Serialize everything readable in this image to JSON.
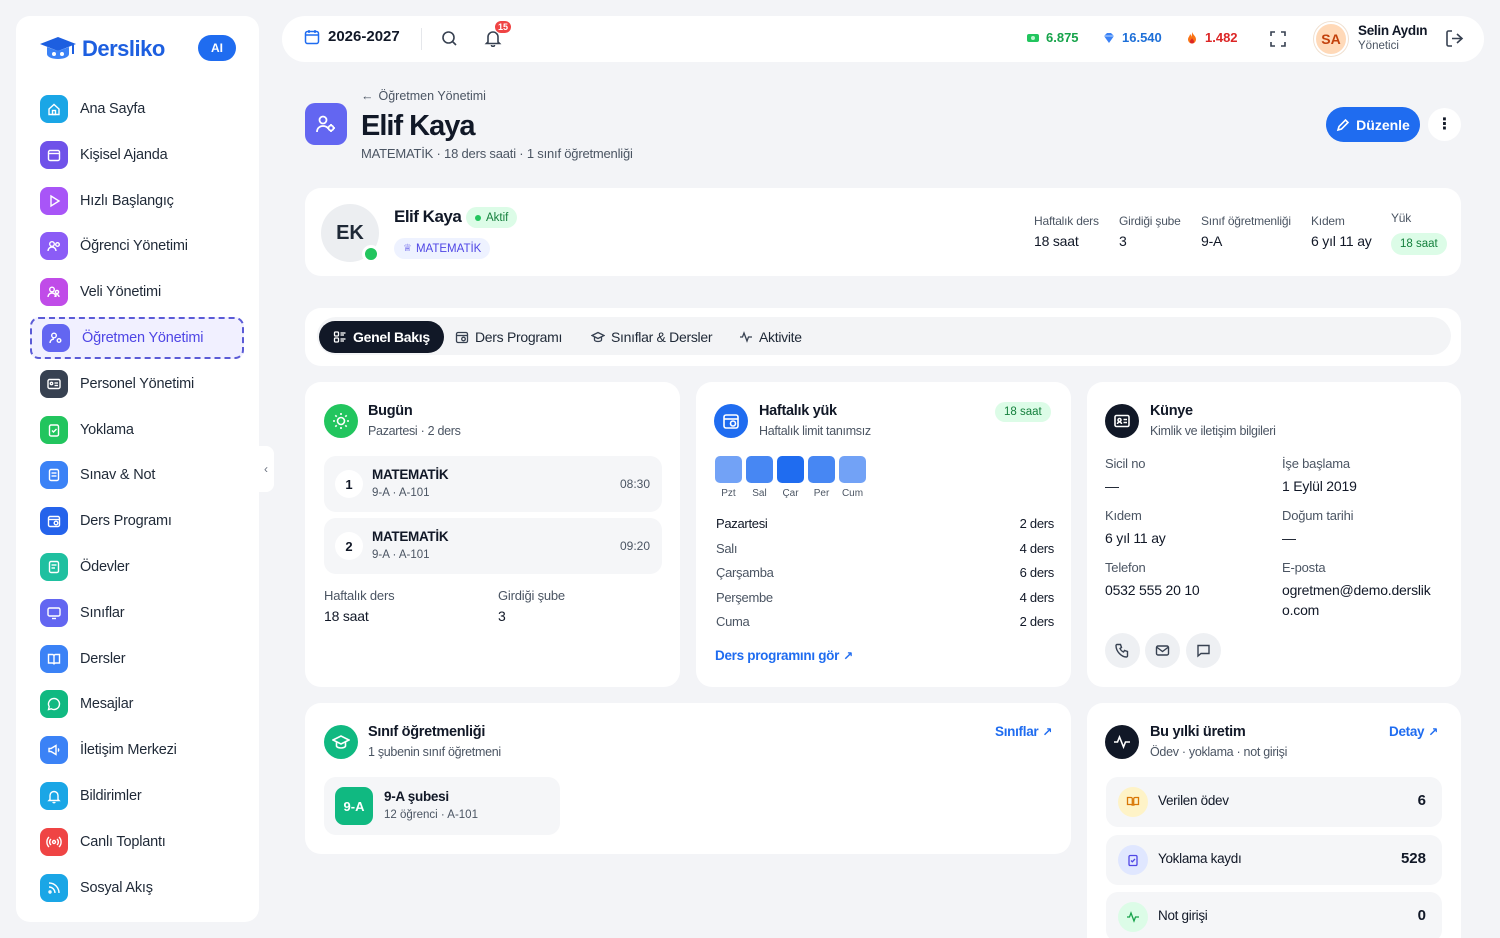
{
  "brand": {
    "name": "Dersliko",
    "ai_badge": "AI"
  },
  "sidebar": {
    "items": [
      {
        "label": "Ana Sayfa",
        "icon": "home-icon",
        "color": "#1aa6e6"
      },
      {
        "label": "Kişisel Ajanda",
        "icon": "calendar-icon",
        "color": "#6f52e9"
      },
      {
        "label": "Hızlı Başlangıç",
        "icon": "play-icon",
        "color": "#a855f7"
      },
      {
        "label": "Öğrenci Yönetimi",
        "icon": "users-icon",
        "color": "#8b5cf6"
      },
      {
        "label": "Veli Yönetimi",
        "icon": "parents-icon",
        "color": "#c04ce8"
      },
      {
        "label": "Öğretmen Yönetimi",
        "icon": "teacher-icon",
        "color": "#6366f1",
        "active": true
      },
      {
        "label": "Personel Yönetimi",
        "icon": "id-card-icon",
        "color": "#374151"
      },
      {
        "label": "Yoklama",
        "icon": "clipboard-check-icon",
        "color": "#22c55e"
      },
      {
        "label": "Sınav & Not",
        "icon": "exam-icon",
        "color": "#3b82f6"
      },
      {
        "label": "Ders Programı",
        "icon": "schedule-icon",
        "color": "#2563eb"
      },
      {
        "label": "Ödevler",
        "icon": "homework-icon",
        "color": "#1fc0a0"
      },
      {
        "label": "Sınıflar",
        "icon": "monitor-icon",
        "color": "#6366f1"
      },
      {
        "label": "Dersler",
        "icon": "book-icon",
        "color": "#3b82f6"
      },
      {
        "label": "Mesajlar",
        "icon": "message-icon",
        "color": "#10b981"
      },
      {
        "label": "İletişim Merkezi",
        "icon": "megaphone-icon",
        "color": "#3b82f6"
      },
      {
        "label": "Bildirimler",
        "icon": "bell-icon",
        "color": "#1aa6e6"
      },
      {
        "label": "Canlı Toplantı",
        "icon": "broadcast-icon",
        "color": "#ef4444"
      },
      {
        "label": "Sosyal Akış",
        "icon": "rss-icon",
        "color": "#1aa6e6"
      }
    ]
  },
  "topbar": {
    "year": "2026-2027",
    "notification_count": "15",
    "stats": [
      {
        "value": "6.875",
        "color": "#16a34a",
        "icon": "cash-icon"
      },
      {
        "value": "16.540",
        "color": "#1d6fd8",
        "icon": "diamond-icon"
      },
      {
        "value": "1.482",
        "color": "#dc2626",
        "icon": "fire-icon"
      }
    ],
    "user": {
      "initials": "SA",
      "name": "Selin Aydın",
      "role": "Yönetici"
    }
  },
  "header": {
    "breadcrumb": "Öğretmen Yönetimi",
    "title": "Elif Kaya",
    "subtitle": "MATEMATİK · 18 ders saati · 1 sınıf öğretmenliği",
    "edit_label": "Düzenle"
  },
  "profile": {
    "initials": "EK",
    "name": "Elif Kaya",
    "status": "Aktif",
    "branch": "MATEMATİK",
    "stats": [
      {
        "label": "Haftalık ders",
        "value": "18 saat"
      },
      {
        "label": "Girdiği şube",
        "value": "3"
      },
      {
        "label": "Sınıf öğretmenliği",
        "value": "9-A"
      },
      {
        "label": "Kıdem",
        "value": "6 yıl 11 ay"
      }
    ],
    "load_label": "Yük",
    "load_value": "18 saat"
  },
  "tabs": [
    {
      "label": "Genel Bakış",
      "icon": "grid-list-icon",
      "active": true
    },
    {
      "label": "Ders Programı",
      "icon": "schedule-icon"
    },
    {
      "label": "Sınıflar & Dersler",
      "icon": "cap-icon"
    },
    {
      "label": "Aktivite",
      "icon": "activity-icon"
    }
  ],
  "today": {
    "title": "Bugün",
    "subtitle": "Pazartesi · 2 ders",
    "lessons": [
      {
        "num": "1",
        "name": "MATEMATİK",
        "room": "9-A · A-101",
        "time": "08:30"
      },
      {
        "num": "2",
        "name": "MATEMATİK",
        "room": "9-A · A-101",
        "time": "09:20"
      }
    ],
    "stats": [
      {
        "label": "Haftalık ders",
        "value": "18 saat"
      },
      {
        "label": "Girdiği şube",
        "value": "3"
      }
    ]
  },
  "weekly": {
    "title": "Haftalık yük",
    "subtitle": "Haftalık limit tanımsız",
    "badge": "18 saat",
    "days": [
      {
        "short": "Pzt",
        "name": "Pazartesi",
        "lessons": "2 ders",
        "level": 2
      },
      {
        "short": "Sal",
        "name": "Salı",
        "lessons": "4 ders",
        "level": 4
      },
      {
        "short": "Çar",
        "name": "Çarşamba",
        "lessons": "6 ders",
        "level": 6
      },
      {
        "short": "Per",
        "name": "Perşembe",
        "lessons": "4 ders",
        "level": 4
      },
      {
        "short": "Cum",
        "name": "Cuma",
        "lessons": "2 ders",
        "level": 2
      }
    ],
    "link": "Ders programını gör"
  },
  "kunye": {
    "title": "Künye",
    "subtitle": "Kimlik ve iletişim bilgileri",
    "fields": [
      {
        "label": "Sicil no",
        "value": "—"
      },
      {
        "label": "İşe başlama",
        "value": "1 Eylül 2019"
      },
      {
        "label": "Kıdem",
        "value": "6 yıl 11 ay"
      },
      {
        "label": "Doğum tarihi",
        "value": "—"
      },
      {
        "label": "Telefon",
        "value": "0532 555 20 10"
      },
      {
        "label": "E-posta",
        "value": "ogretmen@demo.derslik o.com"
      }
    ]
  },
  "class_teacher": {
    "title": "Sınıf öğretmenliği",
    "subtitle": "1 şubenin sınıf öğretmeni",
    "link": "Sınıflar",
    "branch_code": "9-A",
    "branch_name": "9-A şubesi",
    "branch_info": "12 öğrenci · A-101"
  },
  "production": {
    "title": "Bu yılki üretim",
    "subtitle": "Ödev · yoklama · not girişi",
    "link": "Detay",
    "rows": [
      {
        "label": "Verilen ödev",
        "value": "6",
        "icon": "book-icon"
      },
      {
        "label": "Yoklama kaydı",
        "value": "528",
        "icon": "clipboard-icon"
      },
      {
        "label": "Not girişi",
        "value": "0",
        "icon": "activity-icon"
      }
    ]
  }
}
